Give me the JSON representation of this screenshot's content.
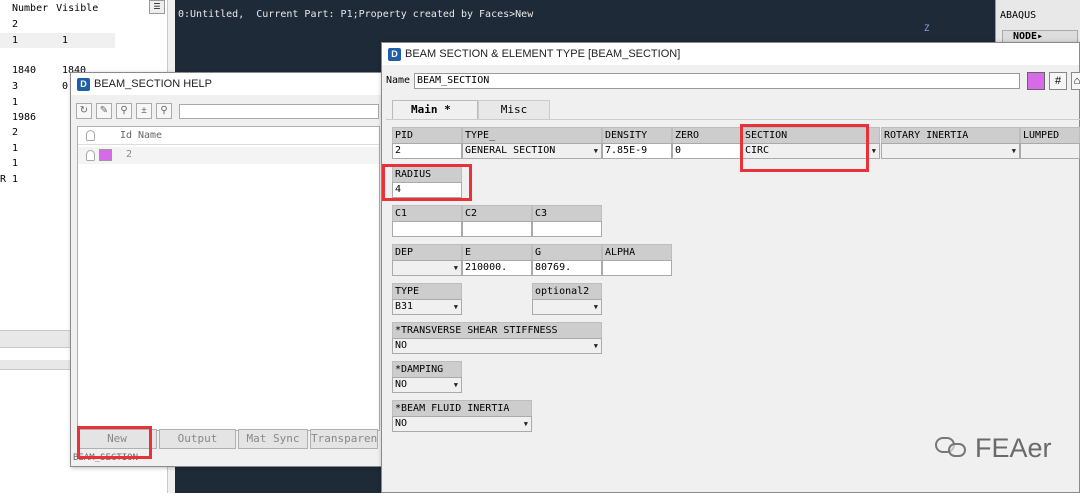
{
  "parts_list": {
    "columns": [
      "Number",
      "Visible"
    ],
    "rows": [
      {
        "c1": "2",
        "c2": ""
      },
      {
        "c1": "1",
        "c2": "1"
      },
      {
        "c1": "1840",
        "c2": "1840"
      },
      {
        "c1": "3",
        "c2": "0"
      },
      {
        "c1": "1",
        "c2": ""
      },
      {
        "c1": "1986",
        "c2": ""
      },
      {
        "c1": "2",
        "c2": ""
      },
      {
        "c1": "1",
        "c2": ""
      },
      {
        "c1": "1",
        "c2": ""
      },
      {
        "c1": "R 1",
        "c2": ""
      }
    ]
  },
  "console": {
    "text": "0:Untitled,  Current Part: P1;Property created by Faces>New",
    "axis_label": "Z"
  },
  "abaqus_panel": {
    "title": "ABAQUS",
    "node_button": "NODE▸"
  },
  "help_dialog": {
    "title": "BEAM_SECTION HELP",
    "columns": {
      "id": "Id",
      "name": "Name"
    },
    "row": {
      "id": "2",
      "color": "#d66be6"
    },
    "buttons": [
      "New",
      "Output",
      "Mat Sync",
      "Transparency"
    ],
    "status": "BEAM_SECTION"
  },
  "beam_dialog": {
    "title": "BEAM SECTION & ELEMENT TYPE [BEAM_SECTION]",
    "name_label": "Name",
    "name_value": "BEAM_SECTION",
    "color": "#d66be6",
    "tabs": [
      "Main *",
      "Misc"
    ],
    "row1": {
      "pid": {
        "label": "PID",
        "value": "2"
      },
      "type": {
        "label": "TYPE_",
        "value": "GENERAL SECTION"
      },
      "density": {
        "label": "DENSITY",
        "value": "7.85E-9"
      },
      "zero": {
        "label": "ZERO",
        "value": "0"
      },
      "section": {
        "label": "SECTION",
        "value": "CIRC"
      },
      "rotary_inertia": {
        "label": "ROTARY INERTIA",
        "value": ""
      },
      "lumped": {
        "label": "LUMPED",
        "value": ""
      }
    },
    "radius": {
      "label": "RADIUS",
      "value": "4"
    },
    "c_fields": [
      {
        "label": "C1",
        "value": ""
      },
      {
        "label": "C2",
        "value": ""
      },
      {
        "label": "C3",
        "value": ""
      }
    ],
    "row4": {
      "dep": {
        "label": "DEP",
        "value": ""
      },
      "e": {
        "label": "E",
        "value": "210000."
      },
      "g": {
        "label": "G",
        "value": "80769."
      },
      "alpha": {
        "label": "ALPHA",
        "value": ""
      }
    },
    "element_type": {
      "label": "TYPE",
      "value": "B31"
    },
    "optional2": {
      "label": "optional2",
      "value": ""
    },
    "transverse_shear": {
      "label": "*TRANSVERSE SHEAR STIFFNESS",
      "value": "NO"
    },
    "damping": {
      "label": "*DAMPING",
      "value": "NO"
    },
    "fluid_inertia": {
      "label": "*BEAM FLUID INERTIA",
      "value": "NO"
    }
  },
  "highlight_color": "#e8323a",
  "watermark": "FEAer"
}
